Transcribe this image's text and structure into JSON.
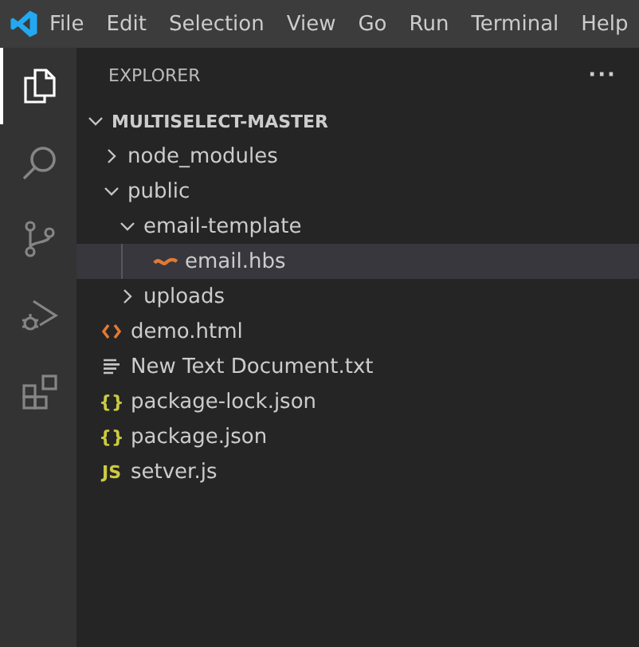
{
  "menu": [
    "File",
    "Edit",
    "Selection",
    "View",
    "Go",
    "Run",
    "Terminal",
    "Help"
  ],
  "activity_bar": [
    {
      "kind": "files",
      "selected": true
    },
    {
      "kind": "search",
      "selected": false
    },
    {
      "kind": "source-control",
      "selected": false
    },
    {
      "kind": "debug",
      "selected": false
    },
    {
      "kind": "extensions",
      "selected": false
    }
  ],
  "sidebar": {
    "title": "EXPLORER",
    "more": "···",
    "tree": [
      {
        "label": "MULTISELECT-MASTER",
        "kind": "root",
        "expanded": true,
        "children": [
          {
            "label": "node_modules",
            "kind": "folder",
            "expanded": false,
            "selected": false
          },
          {
            "label": "public",
            "kind": "folder",
            "expanded": true,
            "selected": false,
            "children": [
              {
                "label": "email-template",
                "kind": "folder",
                "expanded": true,
                "selected": false,
                "children": [
                  {
                    "label": "email.hbs",
                    "kind": "hbs",
                    "selected": true
                  }
                ]
              },
              {
                "label": "uploads",
                "kind": "folder",
                "expanded": false,
                "selected": false
              }
            ]
          },
          {
            "label": "demo.html",
            "kind": "html",
            "selected": false
          },
          {
            "label": "New Text Document.txt",
            "kind": "txt",
            "selected": false
          },
          {
            "label": "package-lock.json",
            "kind": "json",
            "glyph": "{}",
            "selected": false
          },
          {
            "label": "package.json",
            "kind": "json",
            "glyph": "{}",
            "selected": false
          },
          {
            "label": "setver.js",
            "kind": "js",
            "glyph": "JS",
            "selected": false
          }
        ]
      }
    ]
  }
}
